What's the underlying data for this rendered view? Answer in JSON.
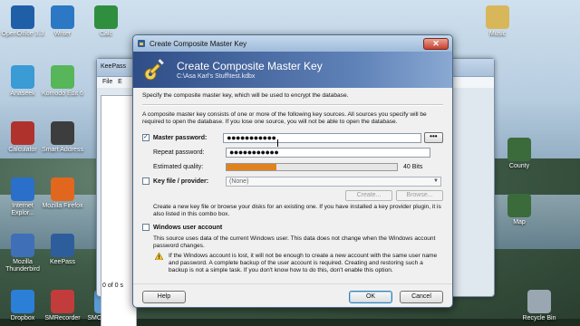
{
  "desktop": {
    "icons": [
      {
        "label": "OpenOffice 3.3",
        "color": "#1f5fa8"
      },
      {
        "label": "Writer",
        "color": "#2c78c4"
      },
      {
        "label": "Calc",
        "color": "#2f8f3f"
      },
      {
        "label": "Anaseek",
        "color": "#3a9bd5"
      },
      {
        "label": "Komodo Edit 6",
        "color": "#57b65a"
      },
      {
        "label": "Calculator",
        "color": "#b0322c"
      },
      {
        "label": "Smart Address",
        "color": "#3d3d3d"
      },
      {
        "label": "Internet Explor...",
        "color": "#2a6fc9"
      },
      {
        "label": "Mozilla Firefox",
        "color": "#e2671e"
      },
      {
        "label": "Mozilla Thunderbird",
        "color": "#3f6fb6"
      },
      {
        "label": "KeePass",
        "color": "#2e5d9c"
      },
      {
        "label": "Dropbox",
        "color": "#2c7fd6"
      },
      {
        "label": "SMRecorder",
        "color": "#c23c3c"
      },
      {
        "label": "SMConverter",
        "color": "#5a9ad2"
      },
      {
        "label": "Music",
        "color": "#d8b65a"
      },
      {
        "label": "Recycle Bin",
        "color": "#9aa7b3"
      },
      {
        "label": "County",
        "color": "#3b6b3b"
      },
      {
        "label": "Map",
        "color": "#3b6b3b"
      }
    ]
  },
  "background_window": {
    "title": "KeePass",
    "menu_file": "File",
    "menu_edit": "E",
    "status": "0 of 0 s"
  },
  "dialog": {
    "window_title": "Create Composite Master Key",
    "close_glyph": "✕",
    "banner_title": "Create Composite Master Key",
    "banner_path": "C:\\Asa Karl's Stuff\\test.kdbx",
    "intro": "Specify the composite master key, which will be used to encrypt the database.",
    "description": "A composite master key consists of one or more of the following key sources. All sources you specify will be required to open the database. If you lose one source, you will not be able to open the database.",
    "master_password": {
      "label": "Master password:",
      "checked": true,
      "value": "●●●●●●●●●●●",
      "toggle_label": "•••"
    },
    "repeat_password": {
      "label": "Repeat password:",
      "value": "●●●●●●●●●●●"
    },
    "quality": {
      "label": "Estimated quality:",
      "fraction": 0.29,
      "text": "40 Bits"
    },
    "key_file": {
      "label": "Key file / provider:",
      "checked": false,
      "selected": "(None)",
      "create_label": "Create...",
      "browse_label": "Browse..."
    },
    "key_file_note": "Create a new key file or browse your disks for an existing one. If you have installed a key provider plugin, it is also listed in this combo box.",
    "windows_account": {
      "label": "Windows user account",
      "checked": false,
      "note": "This source uses data of the current Windows user. This data does not change when the Windows account password changes.",
      "warning": "If the Windows account is lost, it will not be enough to create a new account with the same user name and password. A complete backup of the user account is required. Creating and restoring such a backup is not a simple task. If you don't know how to do this, don't enable this option."
    },
    "help_label": "Help",
    "ok_label": "OK",
    "cancel_label": "Cancel"
  },
  "colors": {
    "banner": "#2f4d87",
    "quality_fill": "#e0831f"
  }
}
